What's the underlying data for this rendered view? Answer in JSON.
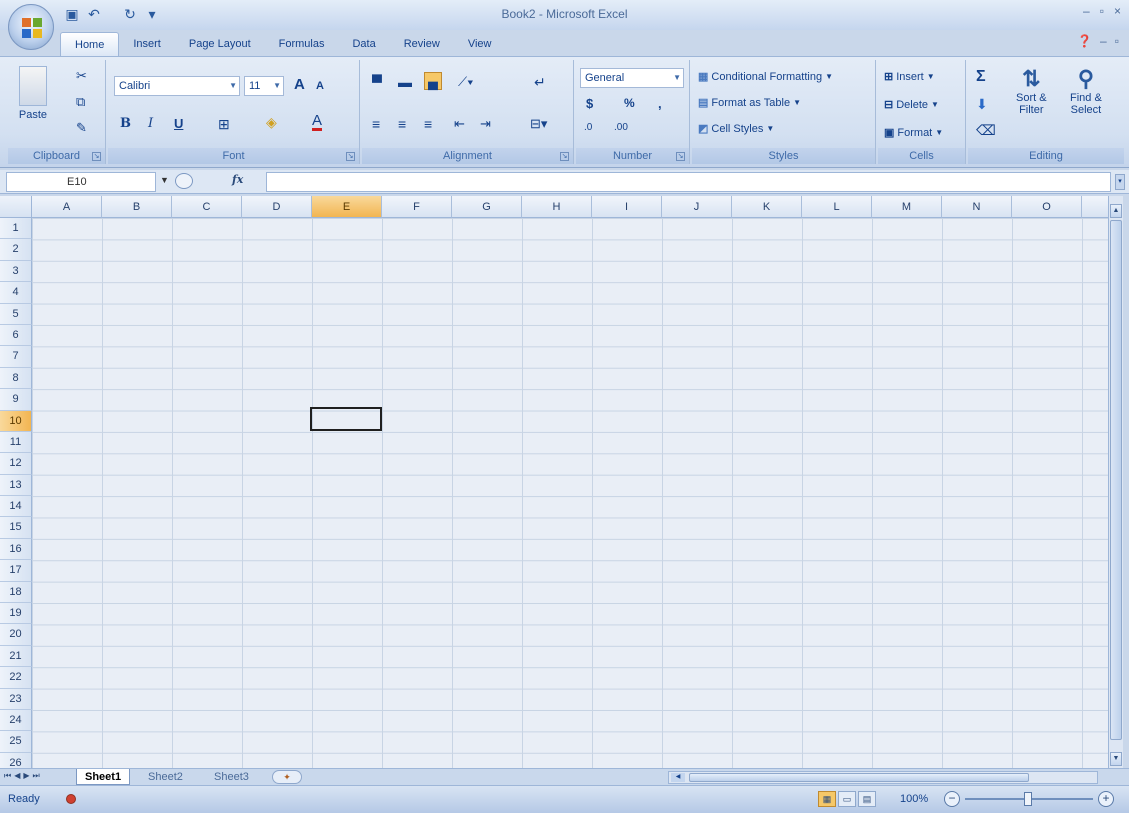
{
  "window": {
    "title": "Book2 - Microsoft Excel",
    "controls": [
      "–",
      "▫",
      "×"
    ]
  },
  "tabs": [
    "Home",
    "Insert",
    "Page Layout",
    "Formulas",
    "Data",
    "Review",
    "View"
  ],
  "ribbon": {
    "clipboard": {
      "label": "Clipboard",
      "paste": "Paste"
    },
    "font": {
      "label": "Font",
      "name": "Calibri",
      "size": "11",
      "bold": "B",
      "italic": "I",
      "underline": "U",
      "grow": "A",
      "shrink": "A",
      "font_color": "A"
    },
    "alignment": {
      "label": "Alignment"
    },
    "number": {
      "label": "Number",
      "format": "General",
      "currency": "$",
      "percent": "%",
      "comma": ",",
      "inc_decimal": ".0",
      "dec_decimal": ".00"
    },
    "styles": {
      "label": "Styles",
      "conditional": "Conditional Formatting",
      "format_table": "Format as Table",
      "cell_styles": "Cell Styles"
    },
    "cells": {
      "label": "Cells",
      "insert": "Insert",
      "delete": "Delete",
      "format": "Format"
    },
    "editing": {
      "label": "Editing",
      "sum": "Σ",
      "sort_filter_line1": "Sort &",
      "sort_filter_line2": "Filter",
      "find_select_line1": "Find &",
      "find_select_line2": "Select"
    }
  },
  "formula_bar": {
    "name_box": "E10",
    "fx": "fx",
    "value": ""
  },
  "columns": [
    "A",
    "B",
    "C",
    "D",
    "E",
    "F",
    "G",
    "H",
    "I",
    "J",
    "K",
    "L",
    "M",
    "N",
    "O"
  ],
  "rows": [
    "1",
    "2",
    "3",
    "4",
    "5",
    "6",
    "7",
    "8",
    "9",
    "10",
    "11",
    "12",
    "13",
    "14",
    "15",
    "16",
    "17",
    "18",
    "19",
    "20",
    "21",
    "22",
    "23",
    "24",
    "25",
    "26"
  ],
  "selection": {
    "column": "E",
    "row": "10"
  },
  "sheets": [
    "Sheet1",
    "Sheet2",
    "Sheet3"
  ],
  "active_sheet": "Sheet1",
  "status": {
    "text": "Ready",
    "zoom": "100%"
  },
  "colors": {
    "selected_header": "#f2b552",
    "ribbon": "#d3e0f1",
    "gridline": "#c8d4e4"
  }
}
